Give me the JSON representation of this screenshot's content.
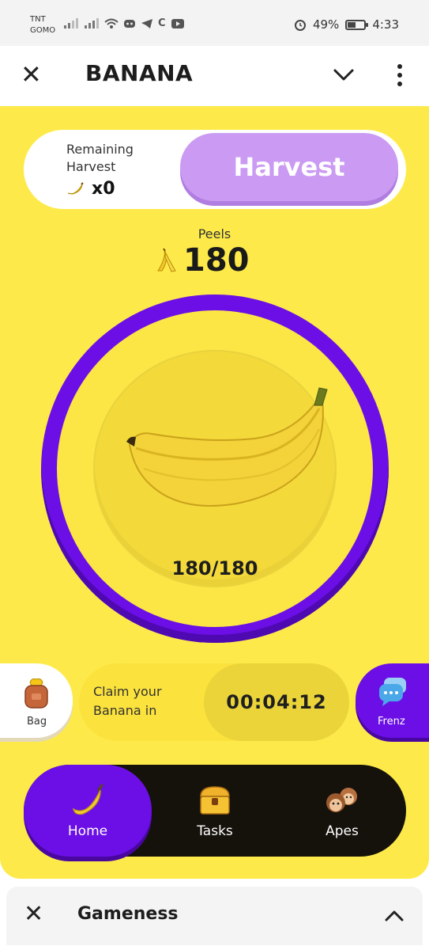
{
  "status_bar": {
    "carrier_line1": "TNT",
    "carrier_line2": "GOMO",
    "battery_percent": "49%",
    "time": "4:33",
    "battery_level": 0.49
  },
  "app_header": {
    "title": "BANANA",
    "close_icon": "close-icon",
    "collapse_icon": "chevron-down-icon",
    "menu_icon": "more-vert-icon"
  },
  "harvest": {
    "remaining_label": "Remaining Harvest",
    "count": "x0",
    "button_label": "Harvest"
  },
  "peels": {
    "label": "Peels",
    "value": "180"
  },
  "energy": {
    "text": "180/180",
    "current": 180,
    "max": 180
  },
  "side": {
    "bag_label": "Bag",
    "frenz_label": "Frenz"
  },
  "claim": {
    "text": "Claim your Banana in",
    "timer": "00:04:12"
  },
  "nav": {
    "items": [
      {
        "label": "Home",
        "icon": "banana-icon"
      },
      {
        "label": "Tasks",
        "icon": "treasure-chest-icon"
      },
      {
        "label": "Apes",
        "icon": "monkeys-icon"
      }
    ],
    "active": "Home"
  },
  "mini_bar": {
    "title": "Gameness"
  },
  "colors": {
    "game_bg": "#fdea4a",
    "purple": "#6b0fe6",
    "harvest_button": "#cb9bf3",
    "nav_bg": "#15120c"
  }
}
